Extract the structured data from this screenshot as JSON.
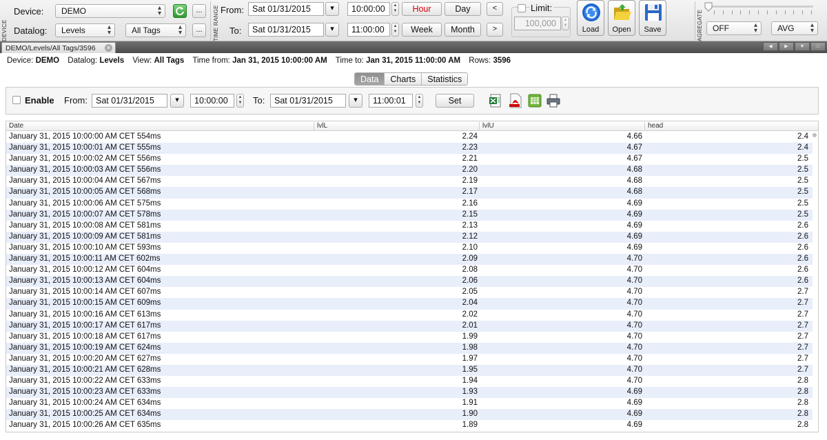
{
  "toolbar": {
    "sections": {
      "device": "DEVICE",
      "time_range": "TIME RANGE",
      "aggregate": "AGREGATE"
    },
    "device_label": "Device:",
    "device_value": "DEMO",
    "datalog_label": "Datalog:",
    "datalog_value": "Levels",
    "tags_value": "All Tags",
    "more": "...",
    "from_label": "From:",
    "from_date": "Sat 01/31/2015",
    "from_time": "10:00:00",
    "to_label": "To:",
    "to_date": "Sat 01/31/2015",
    "to_time": "11:00:00",
    "btn_hour": "Hour",
    "btn_day": "Day",
    "btn_week": "Week",
    "btn_month": "Month",
    "btn_prev": "<",
    "btn_next": ">",
    "limit_label": "Limit:",
    "limit_value": "100,000",
    "load_label": "Load",
    "open_label": "Open",
    "save_label": "Save",
    "aggregate_mode": "OFF",
    "aggregate_func": "AVG",
    "hour_color": "#d8000c"
  },
  "tab": {
    "title": "DEMO/Levels/All Tags/3596"
  },
  "info": {
    "device_label": "Device:",
    "device": "DEMO",
    "datalog_label": "Datalog:",
    "datalog": "Levels",
    "view_label": "View:",
    "view": "All Tags",
    "from_label": "Time from:",
    "from": "Jan 31, 2015 10:00:00 AM",
    "to_label": "Time to:",
    "to": "Jan 31, 2015 11:00:00 AM",
    "rows_label": "Rows:",
    "rows": "3596"
  },
  "views": [
    "Data",
    "Charts",
    "Statistics"
  ],
  "filter": {
    "enable_label": "Enable",
    "from_label": "From:",
    "from_date": "Sat 01/31/2015",
    "from_time": "10:00:00",
    "to_label": "To:",
    "to_date": "Sat 01/31/2015",
    "to_time": "11:00:01",
    "set_label": "Set"
  },
  "table": {
    "columns": [
      "Date",
      "lvlL",
      "lvlU",
      "head"
    ],
    "rows": [
      [
        "January 31, 2015 10:00:00 AM CET 554ms",
        "2.24",
        "4.66",
        "2.4"
      ],
      [
        "January 31, 2015 10:00:01 AM CET 555ms",
        "2.23",
        "4.67",
        "2.4"
      ],
      [
        "January 31, 2015 10:00:02 AM CET 556ms",
        "2.21",
        "4.67",
        "2.5"
      ],
      [
        "January 31, 2015 10:00:03 AM CET 556ms",
        "2.20",
        "4.68",
        "2.5"
      ],
      [
        "January 31, 2015 10:00:04 AM CET 567ms",
        "2.19",
        "4.68",
        "2.5"
      ],
      [
        "January 31, 2015 10:00:05 AM CET 568ms",
        "2.17",
        "4.68",
        "2.5"
      ],
      [
        "January 31, 2015 10:00:06 AM CET 575ms",
        "2.16",
        "4.69",
        "2.5"
      ],
      [
        "January 31, 2015 10:00:07 AM CET 578ms",
        "2.15",
        "4.69",
        "2.5"
      ],
      [
        "January 31, 2015 10:00:08 AM CET 581ms",
        "2.13",
        "4.69",
        "2.6"
      ],
      [
        "January 31, 2015 10:00:09 AM CET 581ms",
        "2.12",
        "4.69",
        "2.6"
      ],
      [
        "January 31, 2015 10:00:10 AM CET 593ms",
        "2.10",
        "4.69",
        "2.6"
      ],
      [
        "January 31, 2015 10:00:11 AM CET 602ms",
        "2.09",
        "4.70",
        "2.6"
      ],
      [
        "January 31, 2015 10:00:12 AM CET 604ms",
        "2.08",
        "4.70",
        "2.6"
      ],
      [
        "January 31, 2015 10:00:13 AM CET 604ms",
        "2.06",
        "4.70",
        "2.6"
      ],
      [
        "January 31, 2015 10:00:14 AM CET 607ms",
        "2.05",
        "4.70",
        "2.7"
      ],
      [
        "January 31, 2015 10:00:15 AM CET 609ms",
        "2.04",
        "4.70",
        "2.7"
      ],
      [
        "January 31, 2015 10:00:16 AM CET 613ms",
        "2.02",
        "4.70",
        "2.7"
      ],
      [
        "January 31, 2015 10:00:17 AM CET 617ms",
        "2.01",
        "4.70",
        "2.7"
      ],
      [
        "January 31, 2015 10:00:18 AM CET 617ms",
        "1.99",
        "4.70",
        "2.7"
      ],
      [
        "January 31, 2015 10:00:19 AM CET 624ms",
        "1.98",
        "4.70",
        "2.7"
      ],
      [
        "January 31, 2015 10:00:20 AM CET 627ms",
        "1.97",
        "4.70",
        "2.7"
      ],
      [
        "January 31, 2015 10:00:21 AM CET 628ms",
        "1.95",
        "4.70",
        "2.7"
      ],
      [
        "January 31, 2015 10:00:22 AM CET 633ms",
        "1.94",
        "4.70",
        "2.8"
      ],
      [
        "January 31, 2015 10:00:23 AM CET 633ms",
        "1.93",
        "4.69",
        "2.8"
      ],
      [
        "January 31, 2015 10:00:24 AM CET 634ms",
        "1.91",
        "4.69",
        "2.8"
      ],
      [
        "January 31, 2015 10:00:25 AM CET 634ms",
        "1.90",
        "4.69",
        "2.8"
      ],
      [
        "January 31, 2015 10:00:26 AM CET 635ms",
        "1.89",
        "4.69",
        "2.8"
      ]
    ]
  }
}
